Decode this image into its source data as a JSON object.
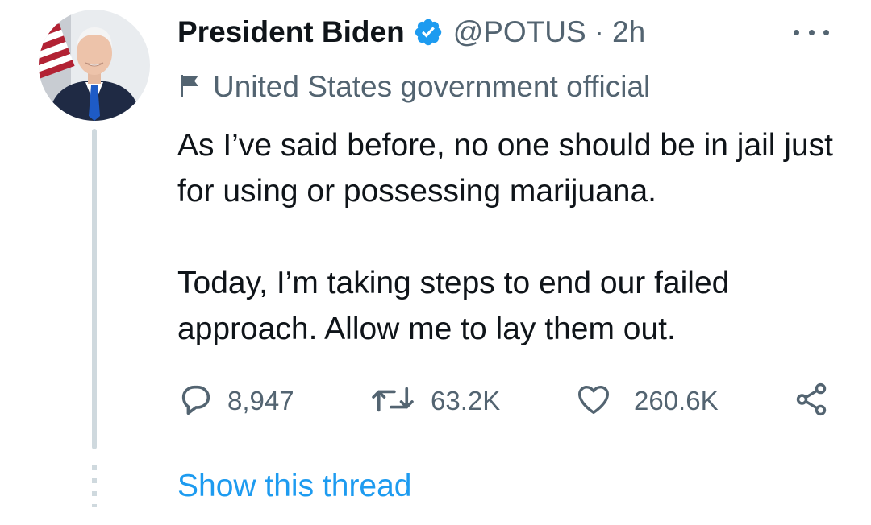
{
  "author": {
    "name": "President Biden",
    "handle": "@POTUS",
    "separator": "·",
    "time": "2h",
    "verified": true,
    "avatar_icon": "profile-photo"
  },
  "account_label": {
    "icon": "flag-icon",
    "text": "United States government official"
  },
  "tweet": {
    "paragraphs": [
      "As I’ve said before, no one should be in jail just for using or possessing marijuana.",
      "Today, I’m taking steps to end our failed approach. Allow me to lay them out."
    ]
  },
  "actions": {
    "replies": "8,947",
    "retweets": "63.2K",
    "likes": "260.6K"
  },
  "show_thread": "Show this thread",
  "colors": {
    "text": "#0f1419",
    "secondary": "#536471",
    "accent": "#1d9bf0",
    "thread_line": "#cfd9de"
  }
}
